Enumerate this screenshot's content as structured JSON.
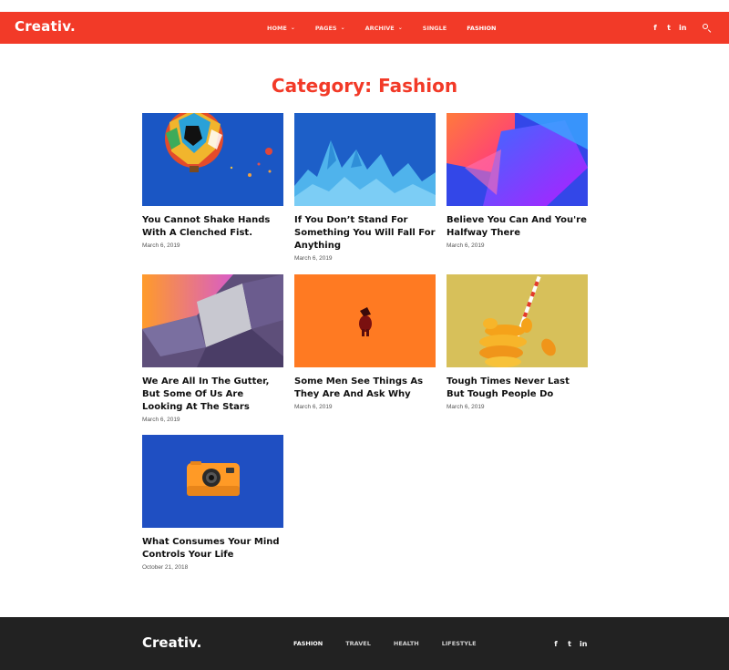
{
  "header": {
    "logo": "Creativ.",
    "nav": [
      {
        "label": "HOME",
        "dropdown": true
      },
      {
        "label": "PAGES",
        "dropdown": true
      },
      {
        "label": "ARCHIVE",
        "dropdown": true
      },
      {
        "label": "SINGLE",
        "dropdown": false
      },
      {
        "label": "FASHION",
        "dropdown": false,
        "active": true
      }
    ],
    "social": [
      "facebook-icon",
      "twitter-icon",
      "linkedin-icon"
    ],
    "social_glyphs": [
      "f",
      "t",
      "in"
    ],
    "search_icon": "search-icon"
  },
  "page": {
    "title": "Category: Fashion"
  },
  "posts": [
    {
      "title": "You Cannot Shake Hands With A Clenched Fist.",
      "date": "March 6, 2019",
      "image": "hot-air-balloon"
    },
    {
      "title": "If You Don’t Stand For Something You Will Fall For Anything",
      "date": "March 6, 2019",
      "image": "blue-waves"
    },
    {
      "title": "Believe You Can And You're Halfway There",
      "date": "March 6, 2019",
      "image": "gradient-shapes"
    },
    {
      "title": "We Are All In The Gutter, But Some Of Us Are Looking At The Stars",
      "date": "March 6, 2019",
      "image": "folded-shapes"
    },
    {
      "title": "Some Men See Things As They Are And Ask Why",
      "date": "March 6, 2019",
      "image": "orange-figure"
    },
    {
      "title": "Tough Times Never Last But Tough People Do",
      "date": "March 6, 2019",
      "image": "orange-slices"
    },
    {
      "title": "What Consumes Your Mind Controls Your Life",
      "date": "October 21, 2018",
      "image": "orange-camera"
    }
  ],
  "footer": {
    "logo": "Creativ.",
    "nav": [
      {
        "label": "FASHION",
        "active": true
      },
      {
        "label": "TRAVEL"
      },
      {
        "label": "HEALTH"
      },
      {
        "label": "LIFESTYLE"
      }
    ],
    "social": [
      "facebook-icon",
      "twitter-icon",
      "linkedin-icon"
    ],
    "social_glyphs": [
      "f",
      "t",
      "in"
    ]
  },
  "colors": {
    "accent": "#f23a28",
    "footer_bg": "#222222"
  }
}
